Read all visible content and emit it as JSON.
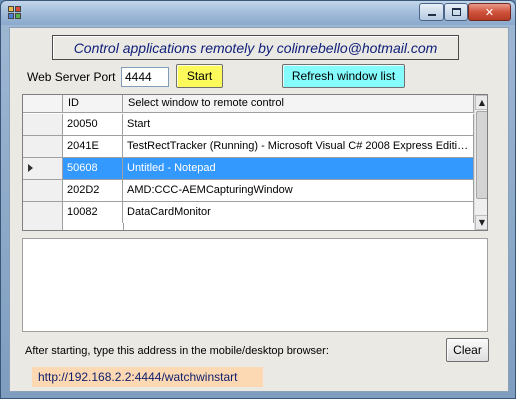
{
  "window": {
    "caption_buttons": {
      "minimize": "minimize-icon",
      "maximize": "maximize-icon",
      "close": "close-icon"
    }
  },
  "banner": {
    "text": "Control applications remotely by colinrebello@hotmail.com"
  },
  "server": {
    "port_label": "Web Server Port",
    "port_value": "4444",
    "start_label": "Start",
    "refresh_label": "Refresh window list"
  },
  "grid": {
    "columns": [
      "ID",
      "Select window to remote control"
    ],
    "rows": [
      {
        "id": "20050",
        "name": "Start"
      },
      {
        "id": "2041E",
        "name": "TestRectTracker (Running) - Microsoft Visual C# 2008 Express Editio..."
      },
      {
        "id": "50608",
        "name": "Untitled - Notepad"
      },
      {
        "id": "202D2",
        "name": "AMD:CCC-AEMCapturingWindow"
      },
      {
        "id": "10082",
        "name": "DataCardMonitor"
      }
    ],
    "selected_index": 2
  },
  "footer": {
    "hint": "After starting, type this address in the mobile/desktop browser:",
    "clear_label": "Clear",
    "url": "http://192.168.2.2:4444/watchwinstart"
  },
  "colors": {
    "start_button": "#fbfa5a",
    "refresh_button": "#86fbfb",
    "url_background": "#fdd9b3",
    "selection": "#3399ff"
  }
}
